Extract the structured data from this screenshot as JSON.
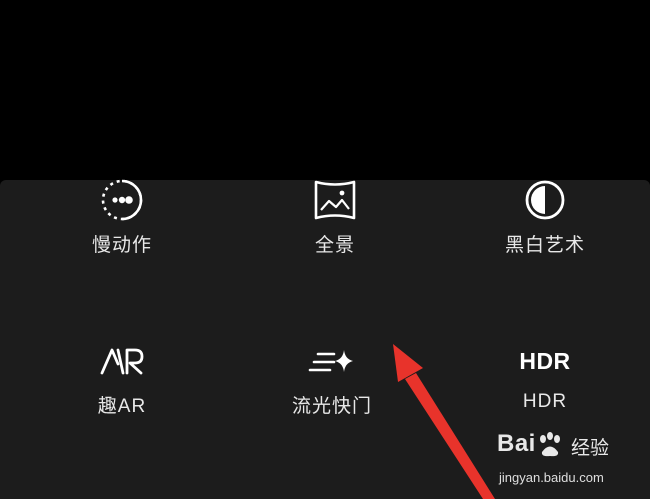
{
  "modes": {
    "slow_motion": {
      "label": "慢动作",
      "icon": "slow-motion-icon"
    },
    "panorama": {
      "label": "全景",
      "icon": "panorama-icon"
    },
    "black_white": {
      "label": "黑白艺术",
      "icon": "black-white-icon"
    },
    "fun_ar": {
      "label": "趣AR",
      "icon": "ar-icon"
    },
    "light_painting": {
      "label": "流光快门",
      "icon": "light-painting-icon"
    },
    "hdr": {
      "label": "HDR",
      "icon_text": "HDR",
      "icon": "hdr-icon"
    }
  },
  "annotation": {
    "icon": "red-arrow-icon",
    "color": "#e8332b"
  },
  "watermark": {
    "logo": "Bai",
    "brand": "经验",
    "url": "jingyan.baidu.com"
  },
  "colors": {
    "panel_background": "#1c1c1c",
    "viewfinder": "#000000",
    "text": "#e8e8e8"
  }
}
